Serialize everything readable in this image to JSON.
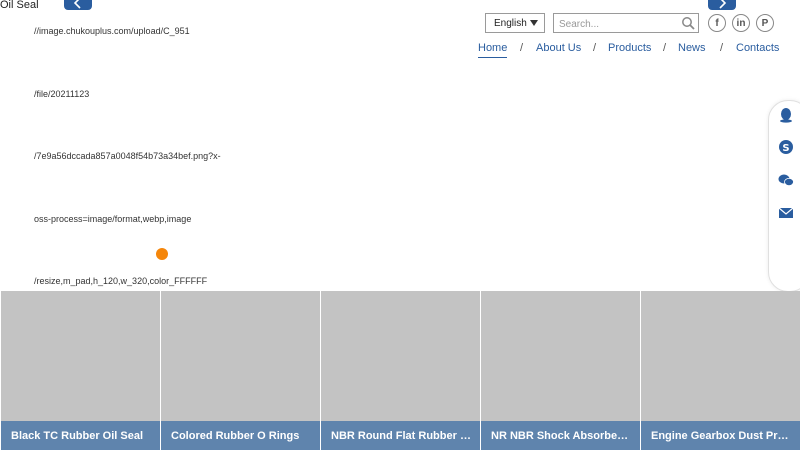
{
  "header": {
    "corner_label": "Oil Seal",
    "language": "English",
    "search_placeholder": "Search...",
    "social": [
      "f",
      "in",
      "P"
    ]
  },
  "broken_image_url": [
    "//image.chukouplus.com/upload/C_951",
    "/file/20211123",
    "/7e9a56dccada857a0048f54b73a34bef.png?x-",
    "oss-process=image/format,webp,image",
    "/resize,m_pad,h_120,w_320,color_FFFFFF"
  ],
  "menu": {
    "items": [
      "Home",
      "About Us",
      "Products",
      "News",
      "Contacts"
    ],
    "separator": "/"
  },
  "products": [
    "Black TC Rubber Oil Seal",
    "Colored Rubber O Rings",
    "NBR Round Flat Rubber Gaskets",
    "NR NBR Shock Absorber Mounts",
    "Engine Gearbox Dust Proof Seals"
  ],
  "colors": {
    "brand_blue": "#2a5d9f",
    "caption_bg": "#5f84ad",
    "card_bg": "#c3c3c3",
    "dot": "#f5860a"
  }
}
